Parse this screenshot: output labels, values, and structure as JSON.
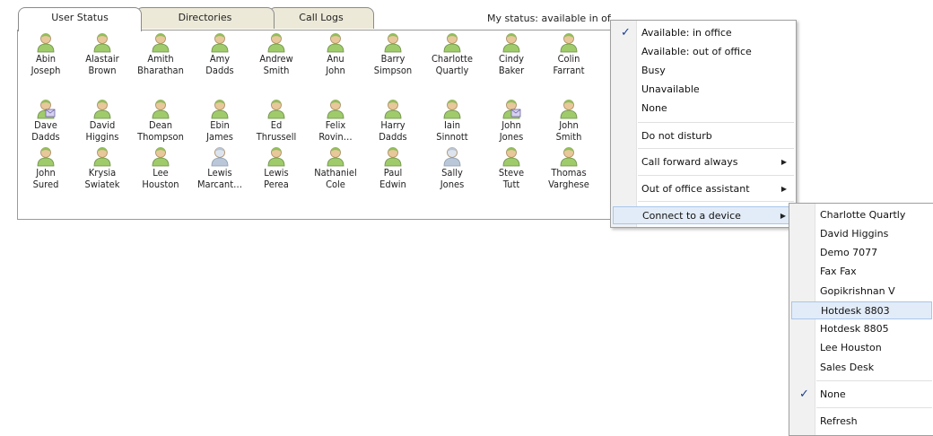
{
  "tabs": [
    {
      "label": "User Status"
    },
    {
      "label": "Directories"
    },
    {
      "label": "Call Logs"
    }
  ],
  "my_status": "My status: available in office",
  "contacts": [
    {
      "name": "Abin\nJoseph",
      "state": "available"
    },
    {
      "name": "Alastair\nBrown",
      "state": "available"
    },
    {
      "name": "Amith\nBharathan",
      "state": "available"
    },
    {
      "name": "Amy\nDadds",
      "state": "available"
    },
    {
      "name": "Andrew\nSmith",
      "state": "available"
    },
    {
      "name": "Anu\nJohn",
      "state": "available"
    },
    {
      "name": "Barry\nSimpson",
      "state": "available"
    },
    {
      "name": "Charlotte\nQuartly",
      "state": "available"
    },
    {
      "name": "Cindy\nBaker",
      "state": "available"
    },
    {
      "name": "Colin\nFarrant",
      "state": "available"
    },
    {
      "name": "Dave\nDadds",
      "state": "message"
    },
    {
      "name": "David\nHiggins",
      "state": "available"
    },
    {
      "name": "Dean\nThompson",
      "state": "available"
    },
    {
      "name": "Ebin\nJames",
      "state": "available"
    },
    {
      "name": "Ed\nThrussell",
      "state": "available"
    },
    {
      "name": "Felix\nRovin…",
      "state": "available"
    },
    {
      "name": "Harry\nDadds",
      "state": "available"
    },
    {
      "name": "Iain\nSinnott",
      "state": "available"
    },
    {
      "name": "John\nJones",
      "state": "message"
    },
    {
      "name": "John\nSmith",
      "state": "available"
    },
    {
      "name": "John\nSured",
      "state": "available"
    },
    {
      "name": "Krysia\nSwiatek",
      "state": "available"
    },
    {
      "name": "Lee\nHouston",
      "state": "available"
    },
    {
      "name": "Lewis\nMarcant…",
      "state": "offline"
    },
    {
      "name": "Lewis\nPerea",
      "state": "available"
    },
    {
      "name": "Nathaniel\nCole",
      "state": "available"
    },
    {
      "name": "Paul\nEdwin",
      "state": "available"
    },
    {
      "name": "Sally\nJones",
      "state": "offline"
    },
    {
      "name": "Steve\nTutt",
      "state": "available"
    },
    {
      "name": "Thomas\nVarghese",
      "state": "available"
    }
  ],
  "status_menu": {
    "items": [
      {
        "label": "Available: in office",
        "checked": true,
        "submenu": false
      },
      {
        "label": "Available: out of office",
        "checked": false,
        "submenu": false
      },
      {
        "label": "Busy",
        "checked": false,
        "submenu": false
      },
      {
        "label": "Unavailable",
        "checked": false,
        "submenu": false
      },
      {
        "label": "None",
        "checked": false,
        "submenu": false
      },
      {
        "label": "Do not disturb",
        "checked": false,
        "submenu": false
      },
      {
        "label": "Call forward always",
        "checked": false,
        "submenu": true
      },
      {
        "label": "Out of office assistant",
        "checked": false,
        "submenu": true
      },
      {
        "label": "Connect to a device",
        "checked": false,
        "submenu": true,
        "highlighted": true
      }
    ]
  },
  "device_menu": {
    "items": [
      {
        "label": "Charlotte Quartly"
      },
      {
        "label": "David Higgins"
      },
      {
        "label": "Demo 7077"
      },
      {
        "label": "Fax Fax"
      },
      {
        "label": "Gopikrishnan V"
      },
      {
        "label": "Hotdesk 8803",
        "highlighted": true
      },
      {
        "label": "Hotdesk 8805"
      },
      {
        "label": "Lee Houston"
      },
      {
        "label": "Sales Desk"
      },
      {
        "label": "None",
        "checked": true
      },
      {
        "label": "Refresh"
      }
    ]
  },
  "colors": {
    "available_body": "#9fcb6b",
    "available_head": "#e8c79a",
    "offline_body": "#b9c7d8",
    "message_badge": "#d8d0f0",
    "menu_highlight": "#e2ecf8",
    "check_mark": "#1c3e8f",
    "inactive_tab": "#ece9d8"
  },
  "icons": {
    "contact": "person-icon",
    "check": "checkmark-icon",
    "submenu": "submenu-arrow-icon"
  }
}
